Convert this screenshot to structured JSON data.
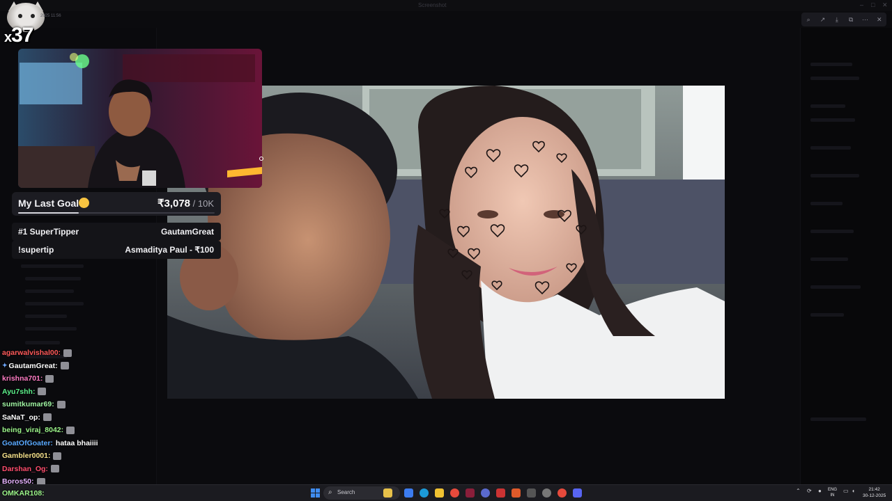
{
  "window": {
    "title": "Screenshot"
  },
  "viewer_toolbar": {
    "icons": [
      "zoom-icon",
      "share-icon",
      "download-icon",
      "expand-icon",
      "more-icon",
      "close-icon"
    ]
  },
  "overlay": {
    "sub_badge": {
      "prefix": "x",
      "count": "37",
      "meta": "2025 11:56"
    },
    "goal": {
      "label": "My Last Goal",
      "emoji": "worried-face",
      "current": "₹3,078",
      "target": " / 10K",
      "progress_fraction": 0.31
    },
    "super_tipper": {
      "label": "#1 SuperTipper",
      "value": "GautamGreat"
    },
    "supertip": {
      "label": "!supertip",
      "value": "Asmaditya Paul - ₹100"
    }
  },
  "chat": {
    "messages": [
      {
        "user": "agarwalvishal00:",
        "color": "#ff5a5a",
        "emote": true,
        "pinned": false,
        "text": ""
      },
      {
        "user": "GautamGreat:",
        "color": "#ffffff",
        "emote": true,
        "pinned": true,
        "text": ""
      },
      {
        "user": "krishna701:",
        "color": "#ff7cc4",
        "emote": true,
        "pinned": false,
        "text": ""
      },
      {
        "user": "Ayu7shh:",
        "color": "#5cf08a",
        "emote": true,
        "pinned": false,
        "text": ""
      },
      {
        "user": "sumitkumar69:",
        "color": "#9ef2a1",
        "emote": true,
        "pinned": false,
        "text": ""
      },
      {
        "user": "SaNaT_op:",
        "color": "#ffffff",
        "emote": true,
        "pinned": false,
        "text": ""
      },
      {
        "user": "being_viraj_8042:",
        "color": "#9cf58a",
        "emote": true,
        "pinned": false,
        "text": ""
      },
      {
        "user": "GoatOfGoater:",
        "color": "#5aa9ff",
        "emote": false,
        "pinned": false,
        "text": "hataa bhaiiii"
      },
      {
        "user": "Gambler0001:",
        "color": "#f5e08a",
        "emote": true,
        "pinned": false,
        "text": ""
      },
      {
        "user": "Darshan_Og:",
        "color": "#ff4d6d",
        "emote": true,
        "pinned": false,
        "text": ""
      },
      {
        "user": "Boros50:",
        "color": "#e6b3ff",
        "emote": true,
        "pinned": false,
        "text": ""
      }
    ],
    "bottom_user": "OMKAR108:"
  },
  "taskbar": {
    "search_placeholder": "Search",
    "lang_top": "ENG",
    "lang_bottom": "IN",
    "time": "21:42",
    "date": "30-12-2025"
  }
}
